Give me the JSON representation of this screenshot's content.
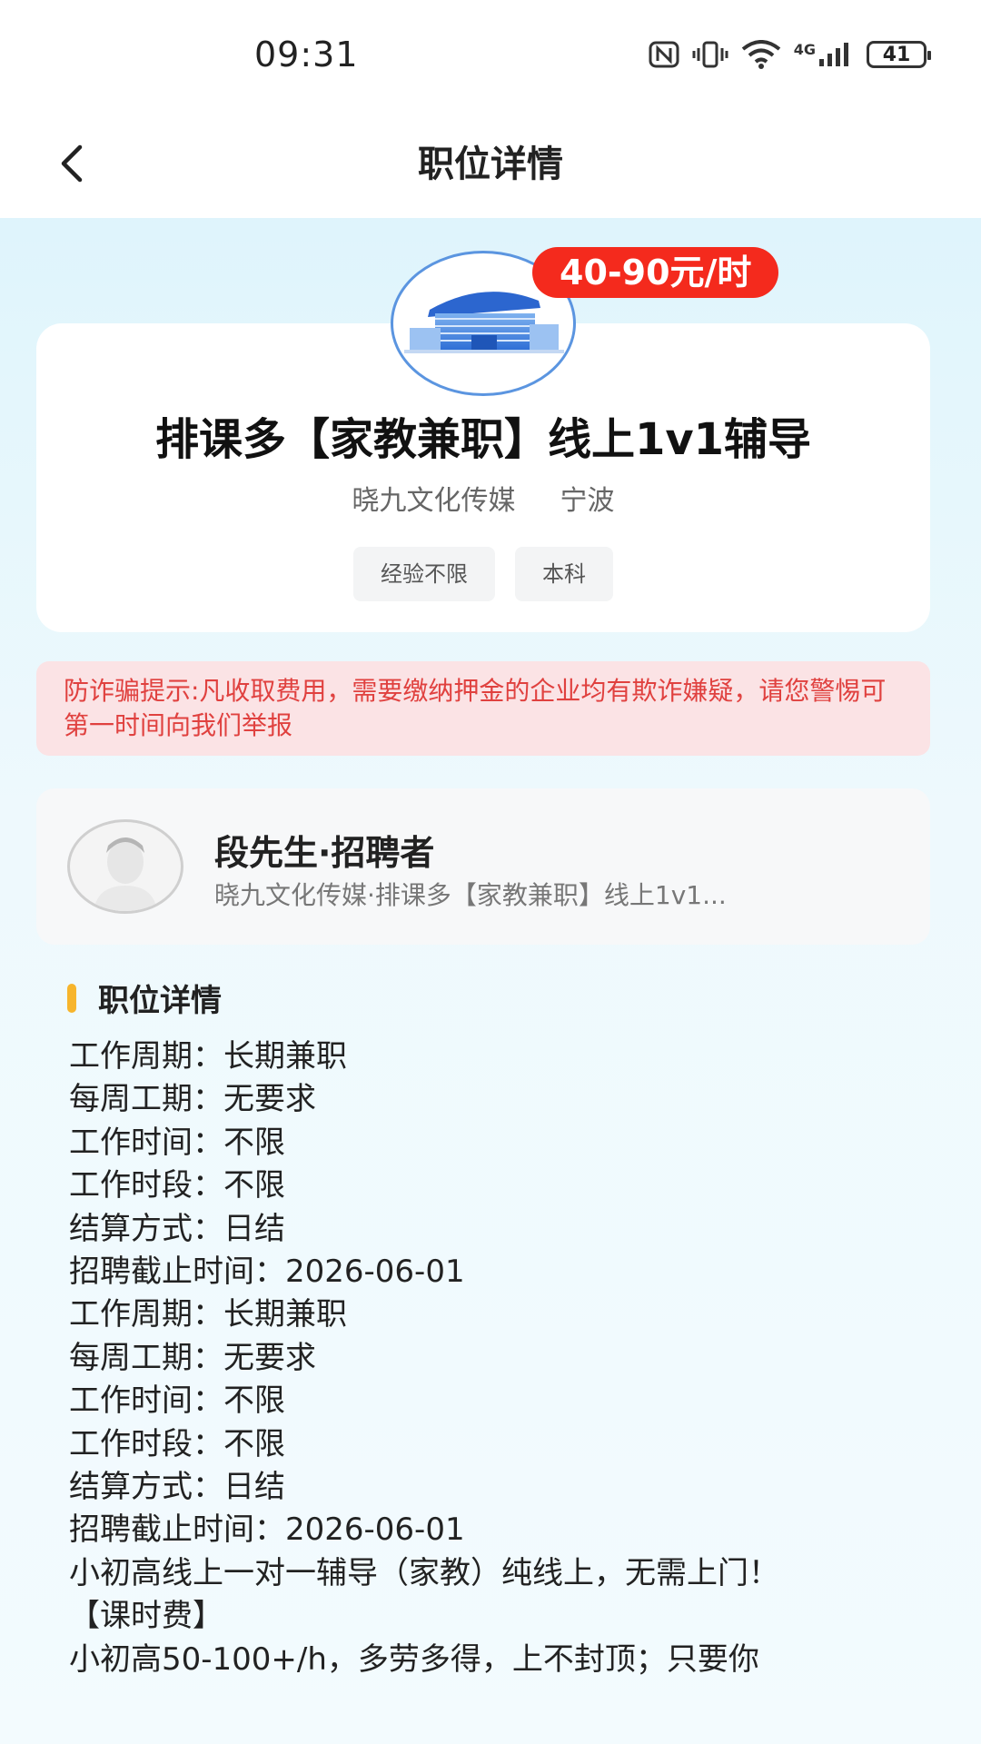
{
  "status_bar": {
    "time": "09:31",
    "network": "4G",
    "battery": "41",
    "icons": [
      "nfc-icon",
      "vibrate-icon",
      "wifi-icon",
      "signal-4g-icon",
      "battery-icon"
    ]
  },
  "nav": {
    "title": "职位详情",
    "back_icon": "chevron-left-icon"
  },
  "job": {
    "salary": "40-90元/时",
    "title": "排课多【家教兼职】线上1v1辅导",
    "company": "晓九文化传媒",
    "city": "宁波",
    "tags": [
      "经验不限",
      "本科"
    ]
  },
  "warning": {
    "text": "防诈骗提示:凡收取费用，需要缴纳押金的企业均有欺诈嫌疑，请您警惕可第一时间向我们举报"
  },
  "recruiter": {
    "name": "段先生·招聘者",
    "subtitle": "晓九文化传媒·排课多【家教兼职】线上1v1..."
  },
  "details": {
    "section_title": "职位详情",
    "rows": [
      "工作周期：长期兼职",
      "每周工期：无要求",
      "工作时间：不限",
      "工作时段：不限",
      "结算方式：日结",
      "招聘截止时间：2026-06-01",
      "工作周期：长期兼职",
      "每周工期：无要求",
      "工作时间：不限",
      "工作时段：不限",
      "结算方式：日结",
      "招聘截止时间：2026-06-01"
    ],
    "description_1": "小初高线上一对一辅导（家教）纯线上，无需上门！",
    "fee_heading": "【课时费】",
    "description_2": "小初高50-100+/h，多劳多得，上不封顶；只要你"
  },
  "colors": {
    "salary_badge": "#f42a1d",
    "warning_bg": "#fbe3e5",
    "warning_text": "#e0413f",
    "section_accent": "#f7b52c",
    "logo_border": "#5b95e0"
  }
}
